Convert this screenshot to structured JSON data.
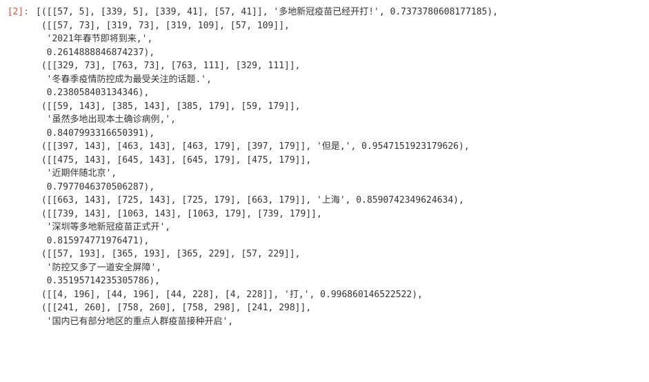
{
  "prompt_label": "[2]:",
  "lines": [
    "[([[57, 5], [339, 5], [339, 41], [57, 41]], '多地新冠疫苗已经开打!', 0.7373780608177185),",
    " ([[57, 73], [319, 73], [319, 109], [57, 109]],",
    "  '2021年春节即将到来,',",
    "  0.2614888846874237),",
    " ([[329, 73], [763, 73], [763, 111], [329, 111]],",
    "  '冬春季疫情防控成为最受关注的话题.',",
    "  0.238058403134346),",
    " ([[59, 143], [385, 143], [385, 179], [59, 179]],",
    "  '虽然多地出现本土确诊病例,',",
    "  0.8407993316650391),",
    " ([[397, 143], [463, 143], [463, 179], [397, 179]], '但是,', 0.9547151923179626),",
    " ([[475, 143], [645, 143], [645, 179], [475, 179]],",
    "  '近期伴随北京',",
    "  0.7977046370506287),",
    " ([[663, 143], [725, 143], [725, 179], [663, 179]], '上海', 0.8590742349624634),",
    " ([[739, 143], [1063, 143], [1063, 179], [739, 179]],",
    "  '深圳等多地新冠疫苗正式开',",
    "  0.815974771976471),",
    " ([[57, 193], [365, 193], [365, 229], [57, 229]],",
    "  '防控又多了一道安全屏障',",
    "  0.35195714235305786),",
    " ([[4, 196], [44, 196], [44, 228], [4, 228]], '打,', 0.996860146522522),",
    " ([[241, 260], [758, 260], [758, 298], [241, 298]],",
    "  '国内已有部分地区的重点人群疫苗接种开启',"
  ]
}
